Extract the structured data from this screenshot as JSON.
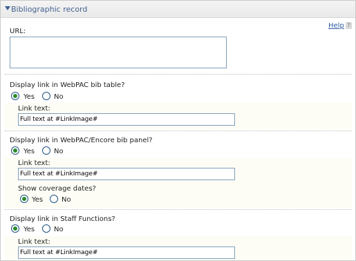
{
  "header": {
    "title": "Bibliographic record"
  },
  "help": {
    "label": "Help",
    "icon": "help-question-icon"
  },
  "url": {
    "label": "URL:",
    "value": ""
  },
  "webpac_table": {
    "question": "Display link in WebPAC bib table?",
    "yes": "Yes",
    "no": "No",
    "selected": "Yes",
    "link_text_label": "Link text:",
    "link_text_value": "Full text at #LinkImage#"
  },
  "encore_panel": {
    "question": "Display link in WebPAC/Encore bib panel?",
    "yes": "Yes",
    "no": "No",
    "selected": "Yes",
    "link_text_label": "Link text:",
    "link_text_value": "Full text at #LinkImage#",
    "coverage_label": "Show coverage dates?",
    "coverage_yes": "Yes",
    "coverage_no": "No",
    "coverage_selected": "Yes"
  },
  "staff_functions": {
    "question": "Display link in Staff Functions?",
    "yes": "Yes",
    "no": "No",
    "selected": "Yes",
    "link_text_label": "Link text:",
    "link_text_value": "Full text at #LinkImage#"
  }
}
